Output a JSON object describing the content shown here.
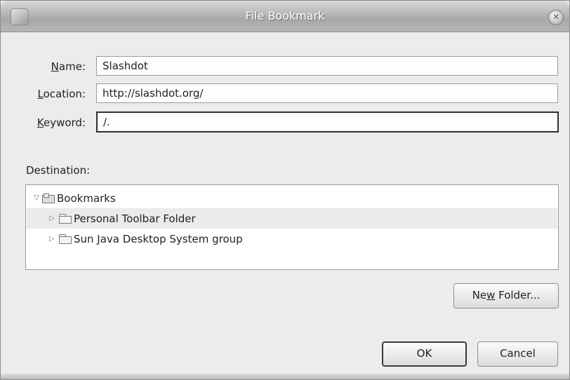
{
  "window": {
    "title": "File Bookmark"
  },
  "form": {
    "name_label_mnemonic": "N",
    "name_label_rest": "ame:",
    "name_value": "Slashdot",
    "location_label_mnemonic": "L",
    "location_label_rest": "ocation:",
    "location_value": "http://slashdot.org/",
    "keyword_label_mnemonic": "K",
    "keyword_label_rest": "eyword:",
    "keyword_value": "/."
  },
  "destination": {
    "label": "Destination:",
    "tree": {
      "root": {
        "label": "Bookmarks",
        "expanded": true
      },
      "children": [
        {
          "label": "Personal Toolbar Folder",
          "selected": true,
          "expanded": false
        },
        {
          "label": "Sun Java Desktop System group",
          "selected": false,
          "expanded": false
        }
      ]
    }
  },
  "buttons": {
    "new_folder_pre": "Ne",
    "new_folder_mnemonic": "w",
    "new_folder_post": " Folder...",
    "ok": "OK",
    "cancel": "Cancel"
  },
  "icons": {
    "app": "bookmark-app-icon",
    "close": "close-icon",
    "expanded": "triangle-down-icon",
    "collapsed": "triangle-right-icon",
    "folder": "folder-icon",
    "bookmarks": "bookmarks-folder-icon"
  }
}
